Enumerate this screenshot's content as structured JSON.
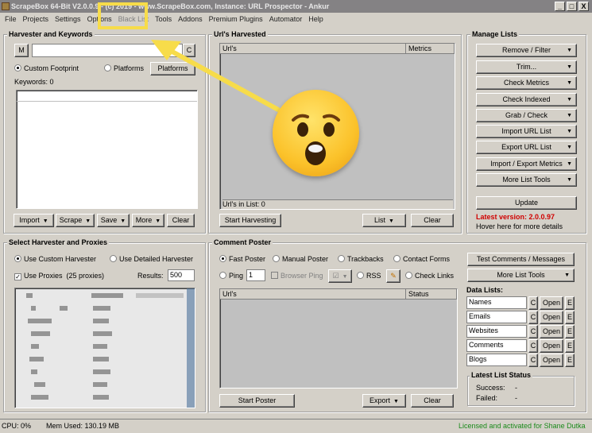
{
  "window": {
    "title": "ScrapeBox 64-Bit V2.0.0.9 - (c) 2019 - www.ScrapeBox.com, Instance: URL Prospector - Ankur",
    "minimize": "_",
    "maximize": "□",
    "close": "X"
  },
  "menu": [
    "File",
    "Projects",
    "Settings",
    "Options",
    "Black List",
    "Tools",
    "Addons",
    "Premium Plugins",
    "Automator",
    "Help"
  ],
  "harvester": {
    "title": "Harvester and Keywords",
    "m_button": "M",
    "c_button": "C",
    "custom_footprint": "Custom Footprint",
    "platforms_radio": "Platforms",
    "platforms_button": "Platforms",
    "keywords_label": "Keywords:",
    "keywords_count": "0",
    "buttons": {
      "import": "Import",
      "scrape": "Scrape",
      "save": "Save",
      "more": "More",
      "clear": "Clear"
    }
  },
  "urls_harvested": {
    "title": "Url's Harvested",
    "col_url": "Url's",
    "col_metrics": "Metrics",
    "in_list_label": "Url's in List:",
    "in_list_count": "0",
    "start_harvesting": "Start Harvesting",
    "list": "List",
    "clear": "Clear"
  },
  "manage_lists": {
    "title": "Manage Lists",
    "buttons": [
      "Remove / Filter",
      "Trim...",
      "Check Metrics",
      "Check Indexed",
      "Grab / Check",
      "Import URL List",
      "Export URL List",
      "Import / Export Metrics",
      "More List Tools"
    ],
    "update": "Update",
    "latest_version": "Latest version:  2.0.0.97",
    "hover_text": "Hover here for more details"
  },
  "harvester_proxies": {
    "title": "Select Harvester and Proxies",
    "use_custom": "Use Custom Harvester",
    "use_detailed": "Use Detailed Harvester",
    "use_proxies": "Use Proxies",
    "proxies_count": "(25 proxies)",
    "results_label": "Results:",
    "results_value": "500"
  },
  "comment_poster": {
    "title": "Comment Poster",
    "fast_poster": "Fast Poster",
    "manual_poster": "Manual Poster",
    "trackbacks": "Trackbacks",
    "contact_forms": "Contact Forms",
    "ping": "Ping",
    "ping_value": "1",
    "browser_ping": "Browser Ping",
    "rss": "RSS",
    "check_links": "Check Links",
    "col_url": "Url's",
    "col_status": "Status",
    "start_poster": "Start Poster",
    "export": "Export",
    "clear": "Clear",
    "test_comments": "Test Comments / Messages",
    "more_list_tools": "More List Tools"
  },
  "data_lists": {
    "title": "Data Lists:",
    "items": [
      {
        "name": "Names",
        "c": "C",
        "open": "Open",
        "e": "E"
      },
      {
        "name": "Emails",
        "c": "C",
        "open": "Open",
        "e": "E"
      },
      {
        "name": "Websites",
        "c": "C",
        "open": "Open",
        "e": "E"
      },
      {
        "name": "Comments",
        "c": "C",
        "open": "Open",
        "e": "E"
      },
      {
        "name": "Blogs",
        "c": "C",
        "open": "Open",
        "e": "E"
      }
    ]
  },
  "latest_status": {
    "title": "Latest List Status",
    "success_label": "Success:",
    "success_value": "-",
    "failed_label": "Failed:",
    "failed_value": "-"
  },
  "statusbar": {
    "cpu": "CPU:  0%",
    "mem": "Mem Used:  130.19 MB",
    "license": "Licensed and activated for Shane Dutka"
  },
  "colors": {
    "highlight": "#f7dc4a",
    "license_text": "#1a8a1a",
    "version_text": "#d00000"
  },
  "overlay": {
    "emoji": "astonished-face",
    "arrow_target": "Black List"
  }
}
